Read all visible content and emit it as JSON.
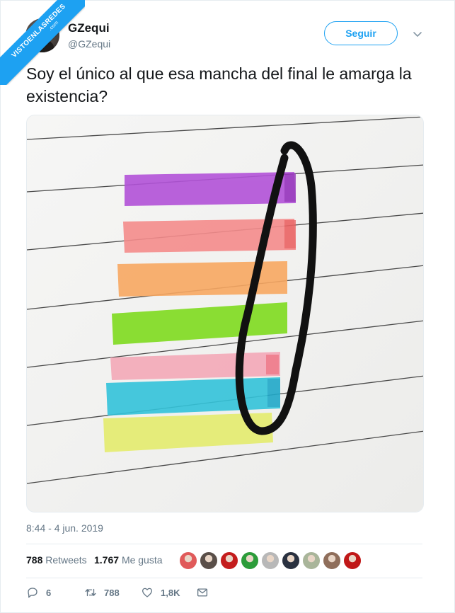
{
  "watermark": {
    "main": "VISTOENLASREDES",
    "sub": ".com"
  },
  "author": {
    "name": "GZequi",
    "handle": "@GZequi"
  },
  "follow_label": "Seguir",
  "tweet_text": "Soy el único al que esa mancha del final le amarga la existencia?",
  "timestamp": "8:44 - 4 jun. 2019",
  "stats": {
    "retweets_count": "788",
    "retweets_label": "Retweets",
    "likes_count": "1.767",
    "likes_label": "Me gusta"
  },
  "likers": [
    "#e05a5a",
    "#5a4f49",
    "#c41d1d",
    "#2c9c3a",
    "#b8b8b8",
    "#2a3140",
    "#a9b59a",
    "#8f6e5b",
    "#c01818"
  ],
  "actions": {
    "replies": "6",
    "retweets": "788",
    "likes": "1,8K"
  },
  "colors": {
    "accent": "#1da1f2",
    "secondary_text": "#657786",
    "border": "#e6ecf0"
  },
  "icons": [
    "caret-down-icon",
    "reply-icon",
    "retweet-icon",
    "heart-icon",
    "message-icon"
  ]
}
